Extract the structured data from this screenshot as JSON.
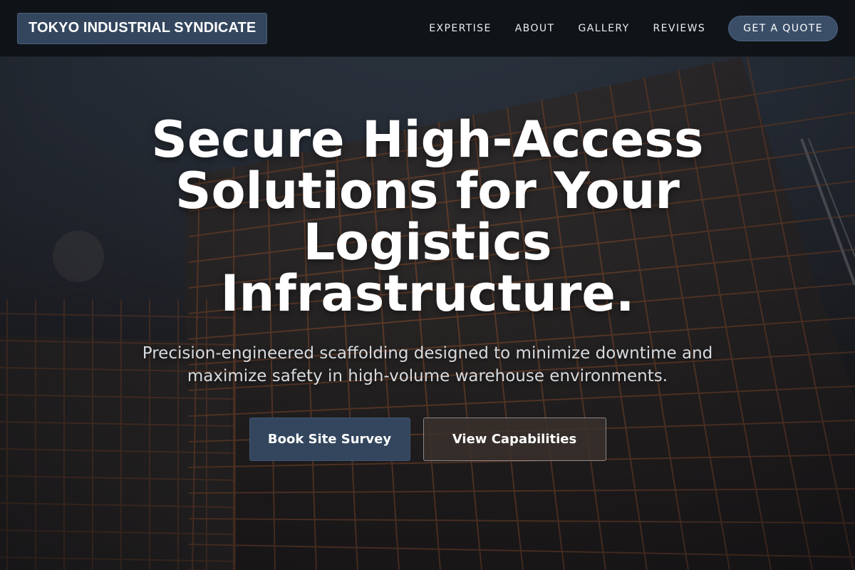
{
  "header": {
    "logo_text": "TOKYO INDUSTRIAL SYNDICATE",
    "nav": {
      "expertise": "EXPERTISE",
      "about": "ABOUT",
      "gallery": "GALLERY",
      "reviews": "REVIEWS"
    },
    "cta_label": "GET A QUOTE"
  },
  "hero": {
    "title": "Secure High-Access Solutions for Your Logistics Infrastructure.",
    "subtitle": "Precision-engineered scaffolding designed to minimize downtime and maximize safety in high-volume warehouse environments.",
    "primary_button": "Book Site Survey",
    "secondary_button": "View Capabilities"
  },
  "colors": {
    "brand": "#33465e",
    "header_bg": "#0e1116",
    "secondary_button_bg": "#3a302c",
    "text": "#ffffff"
  }
}
